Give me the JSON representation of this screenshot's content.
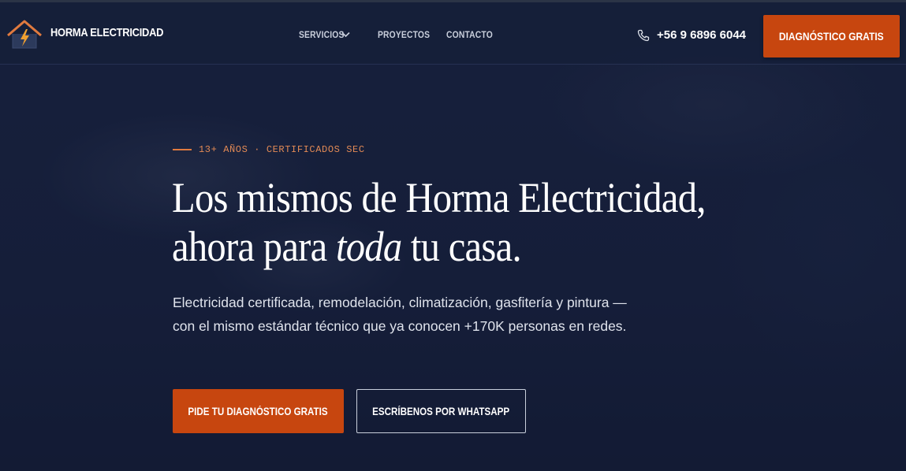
{
  "header": {
    "brand": "HORMA ELECTRICIDAD",
    "nav": {
      "servicios": "SERVICIOS",
      "proyectos": "PROYECTOS",
      "contacto": "CONTACTO"
    },
    "phone": "+56 9 6896 6044",
    "cta": "DIAGNÓSTICO GRATIS"
  },
  "hero": {
    "eyebrow": "13+ AÑOS · CERTIFICADOS SEC",
    "headline_line1": "Los mismos de Horma Electricidad,",
    "headline_line2_start": "ahora para ",
    "headline_line2_em": "toda",
    "headline_line2_end": " tu casa.",
    "subtitle": "Electricidad certificada, remodelación, climatización, gasfitería y pintura — con el mismo estándar técnico que ya conocen +170K personas en redes.",
    "primary_button": "PIDE TU DIAGNÓSTICO GRATIS",
    "secondary_button": "ESCRÍBENOS POR WHATSAPP"
  },
  "icons": {
    "logo": "house-lightning-logo",
    "dropdown": "chevron-down-icon",
    "phone": "phone-icon"
  },
  "colors": {
    "accent": "#c7460f",
    "background": "#16203b",
    "eyebrow": "#e38a55"
  }
}
